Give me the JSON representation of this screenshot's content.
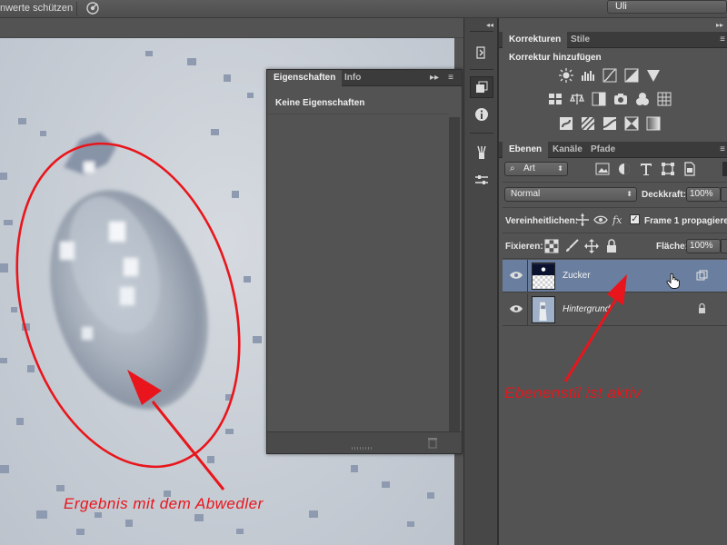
{
  "options_bar": {
    "protect_label": "nwerte schützen",
    "profile": "Uli"
  },
  "properties_panel": {
    "tabs": [
      "Eigenschaften",
      "Info"
    ],
    "empty_label": "Keine Eigenschaften"
  },
  "adjustments_panel": {
    "tabs": [
      "Korrekturen",
      "Stile"
    ],
    "title": "Korrektur hinzufügen"
  },
  "layers_panel": {
    "tabs": [
      "Ebenen",
      "Kanäle",
      "Pfade"
    ],
    "filter_kind": "Art",
    "blend_mode": "Normal",
    "opacity_label": "Deckkraft:",
    "opacity_value": "100%",
    "unify_label": "Vereinheitlichen:",
    "propagate_label": "Frame 1 propagiere",
    "lock_label": "Fixieren:",
    "fill_label": "Fläche:",
    "fill_value": "100%",
    "layers": [
      {
        "name": "Zucker",
        "selected": true,
        "visible": true
      },
      {
        "name": "Hintergrund",
        "selected": false,
        "visible": true,
        "locked": true
      }
    ]
  },
  "annotations": {
    "layer_style": "Ebenenstil ist aktiv",
    "dodge_result": "Ergebnis mit dem Abwedler"
  },
  "colors": {
    "annotation_red": "#e8161c",
    "selected_layer": "#6a7f9f",
    "panel_bg": "#535353"
  }
}
